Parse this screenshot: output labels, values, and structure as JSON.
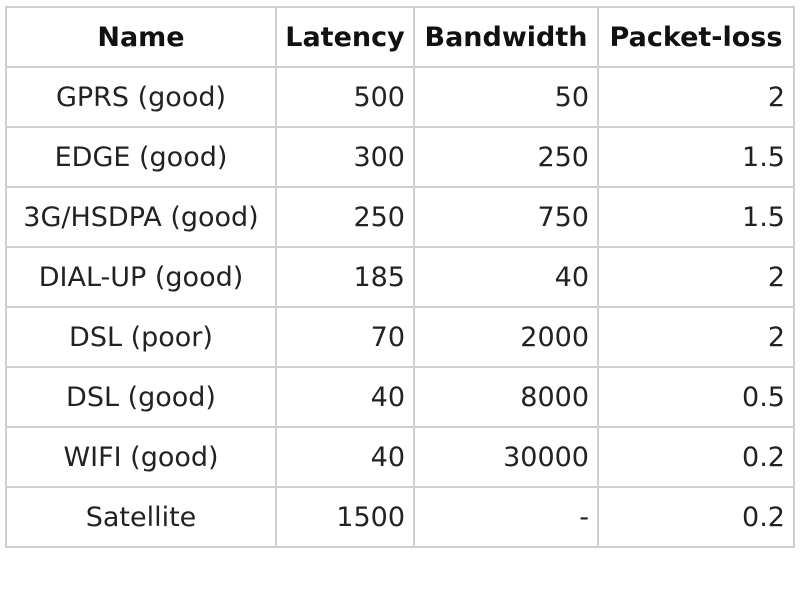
{
  "table": {
    "headers": [
      "Name",
      "Latency",
      "Bandwidth",
      "Packet-loss"
    ],
    "rows": [
      [
        "GPRS (good)",
        "500",
        "50",
        "2"
      ],
      [
        "EDGE (good)",
        "300",
        "250",
        "1.5"
      ],
      [
        "3G/HSDPA (good)",
        "250",
        "750",
        "1.5"
      ],
      [
        "DIAL-UP (good)",
        "185",
        "40",
        "2"
      ],
      [
        "DSL (poor)",
        "70",
        "2000",
        "2"
      ],
      [
        "DSL (good)",
        "40",
        "8000",
        "0.5"
      ],
      [
        "WIFI (good)",
        "40",
        "30000",
        "0.2"
      ],
      [
        "Satellite",
        "1500",
        "-",
        "0.2"
      ]
    ]
  },
  "colors": {
    "border": "#cfcfcf",
    "text": "#222222",
    "header_text": "#111111",
    "background": "#ffffff"
  }
}
